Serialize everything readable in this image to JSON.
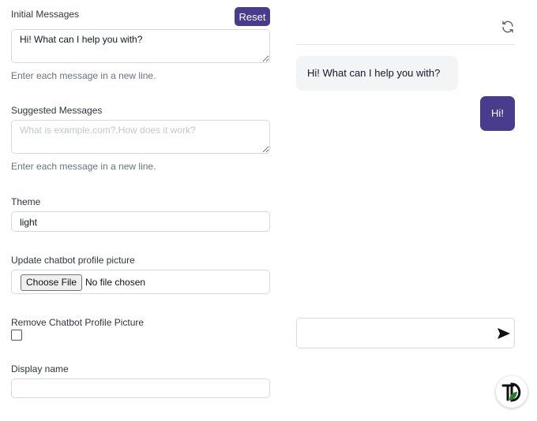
{
  "form": {
    "initial_messages_label": "Initial Messages",
    "reset_label": "Reset",
    "initial_messages_value": "Hi! What can I help you with?",
    "initial_messages_help": "Enter each message in a new line.",
    "suggested_messages_label": "Suggested Messages",
    "suggested_messages_placeholder": "What is example.com?,How does it work?",
    "suggested_messages_help": "Enter each message in a new line.",
    "theme_label": "Theme",
    "theme_value": "light",
    "profile_picture_label": "Update chatbot profile picture",
    "choose_file_label": "Choose File",
    "no_file_text": "No file chosen",
    "remove_picture_label": "Remove Chatbot Profile Picture",
    "display_name_label": "Display name",
    "display_name_value": ""
  },
  "chat": {
    "messages": [
      {
        "role": "bot",
        "text": "Hi! What can I help you with?"
      },
      {
        "role": "user",
        "text": "Hi!"
      }
    ],
    "input_value": "",
    "icons": {
      "refresh": "refresh-icon",
      "send": "send-icon",
      "logo": "brand-logo"
    }
  },
  "colors": {
    "accent": "#4a3c8c",
    "bot_bubble": "#f3f4f6",
    "logo_green": "#2e7d32"
  }
}
